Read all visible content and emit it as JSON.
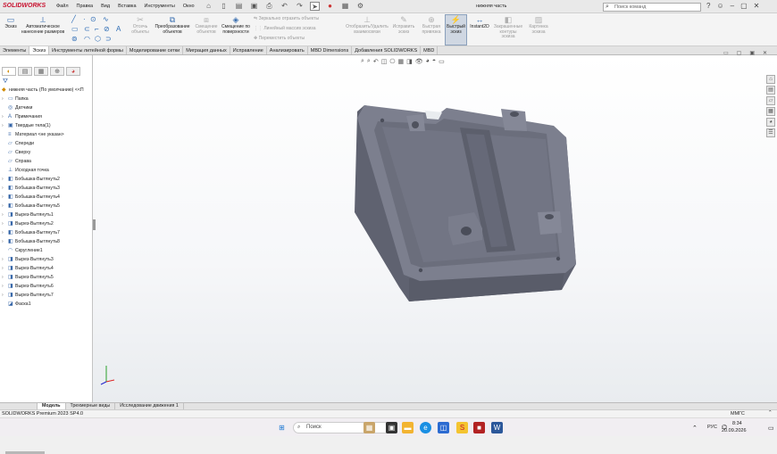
{
  "app": {
    "logo": "SOLIDWORKS",
    "doc_title": "нижняя часть"
  },
  "menu": [
    "Файл",
    "Правка",
    "Вид",
    "Вставка",
    "Инструменты",
    "Окно"
  ],
  "search": {
    "placeholder": "Поиск команд"
  },
  "ribbon": {
    "sketch": "Эскиз",
    "smart_dim": "Автоматическое нанесение размеров",
    "offset_entities": "Отсечь объекты",
    "convert_entities": "Преобразование объектов",
    "offset_ent": "Смещение объектов",
    "offset_surface": "Смещение по поверхности",
    "mirror": "Зеркально отразить объекты",
    "linear_pattern": "Линейный массив эскиза",
    "move": "Переместить объекты",
    "display_relations": "Отобразить/Удалить взаимосвязи",
    "repair": "Исправить эскиз",
    "quick_snaps": "Быстрая привязка",
    "rapid_sketch": "Быстрый эскиз",
    "instant2d": "Instant2D",
    "shaded_contours": "Закрашенные контуры эскиза",
    "sketch_picture": "Картинка эскиза"
  },
  "colors": {
    "accent": "#2f6db5",
    "brand": "#c8102e",
    "part_body": "#6f7282"
  },
  "command_tabs": [
    "Элементы",
    "Эскиз",
    "Инструменты литейной формы",
    "Моделирование сетки",
    "Миграция данных",
    "Исправление",
    "Анализировать",
    "MBD Dimensions",
    "Добавления SOLIDWORKS",
    "MBD"
  ],
  "tree": {
    "root": "нижняя часть  (По умолчанию) <<П",
    "items": [
      {
        "label": "Папка",
        "icon": "folder-icon"
      },
      {
        "label": "Датчики",
        "icon": "sensor-icon"
      },
      {
        "label": "Примечания",
        "icon": "annotation-icon"
      },
      {
        "label": "Твердые тела(1)",
        "icon": "solid-bodies-icon"
      },
      {
        "label": "Материал <не указан>",
        "icon": "material-icon"
      },
      {
        "label": "Спереди",
        "icon": "plane-icon"
      },
      {
        "label": "Сверху",
        "icon": "plane-icon"
      },
      {
        "label": "Справа",
        "icon": "plane-icon"
      },
      {
        "label": "Исходная точка",
        "icon": "origin-icon"
      },
      {
        "label": "Бобышка-Вытянуть2",
        "icon": "boss-extrude-icon"
      },
      {
        "label": "Бобышка-Вытянуть3",
        "icon": "boss-extrude-icon"
      },
      {
        "label": "Бобышка-Вытянуть4",
        "icon": "boss-extrude-icon"
      },
      {
        "label": "Бобышка-Вытянуть5",
        "icon": "boss-extrude-icon"
      },
      {
        "label": "Вырез-Вытянуть1",
        "icon": "cut-extrude-icon"
      },
      {
        "label": "Вырез-Вытянуть2",
        "icon": "cut-extrude-icon"
      },
      {
        "label": "Бобышка-Вытянуть7",
        "icon": "boss-extrude-icon"
      },
      {
        "label": "Бобышка-Вытянуть8",
        "icon": "boss-extrude-icon"
      },
      {
        "label": "Скругление1",
        "icon": "fillet-icon"
      },
      {
        "label": "Вырез-Вытянуть3",
        "icon": "cut-extrude-icon"
      },
      {
        "label": "Вырез-Вытянуть4",
        "icon": "cut-extrude-icon"
      },
      {
        "label": "Вырез-Вытянуть5",
        "icon": "cut-extrude-icon"
      },
      {
        "label": "Вырез-Вытянуть6",
        "icon": "cut-extrude-icon"
      },
      {
        "label": "Вырез-Вытянуть7",
        "icon": "cut-extrude-icon"
      },
      {
        "label": "Фаска1",
        "icon": "chamfer-icon"
      }
    ]
  },
  "bottom_tabs": [
    "Модель",
    "Трехмерные виды",
    "Исследование движения 1"
  ],
  "status": {
    "left": "SOLIDWORKS Premium 2023 SP4.0",
    "units": "ММГС"
  },
  "taskbar": {
    "search": "Поиск",
    "lang": "РУС",
    "time": "8:34",
    "date": "20.09.2026"
  }
}
